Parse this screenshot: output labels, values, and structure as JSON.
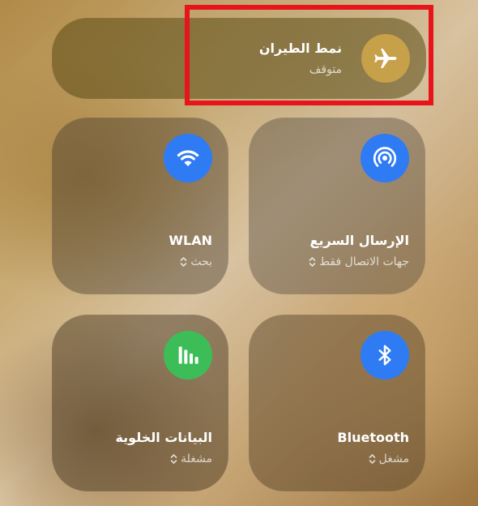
{
  "airplane": {
    "title": "نمط الطيران",
    "status": "متوقف",
    "icon": "airplane-icon"
  },
  "wlan": {
    "title": "WLAN",
    "status": "بحث",
    "icon": "wifi-icon"
  },
  "share": {
    "title": "الإرسال السريع",
    "status": "جهات الاتصال فقط",
    "icon": "broadcast-icon"
  },
  "cellular": {
    "title": "البيانات الخلوية",
    "status": "مشغلة",
    "icon": "cellular-bars-icon"
  },
  "bluetooth": {
    "title": "Bluetooth",
    "status": "مشغل",
    "icon": "bluetooth-icon"
  },
  "colors": {
    "airplane_accent": "#c7a04a",
    "blue_accent": "#2f7bf3",
    "green_accent": "#3dbd57",
    "highlight_box": "#e8141b"
  }
}
